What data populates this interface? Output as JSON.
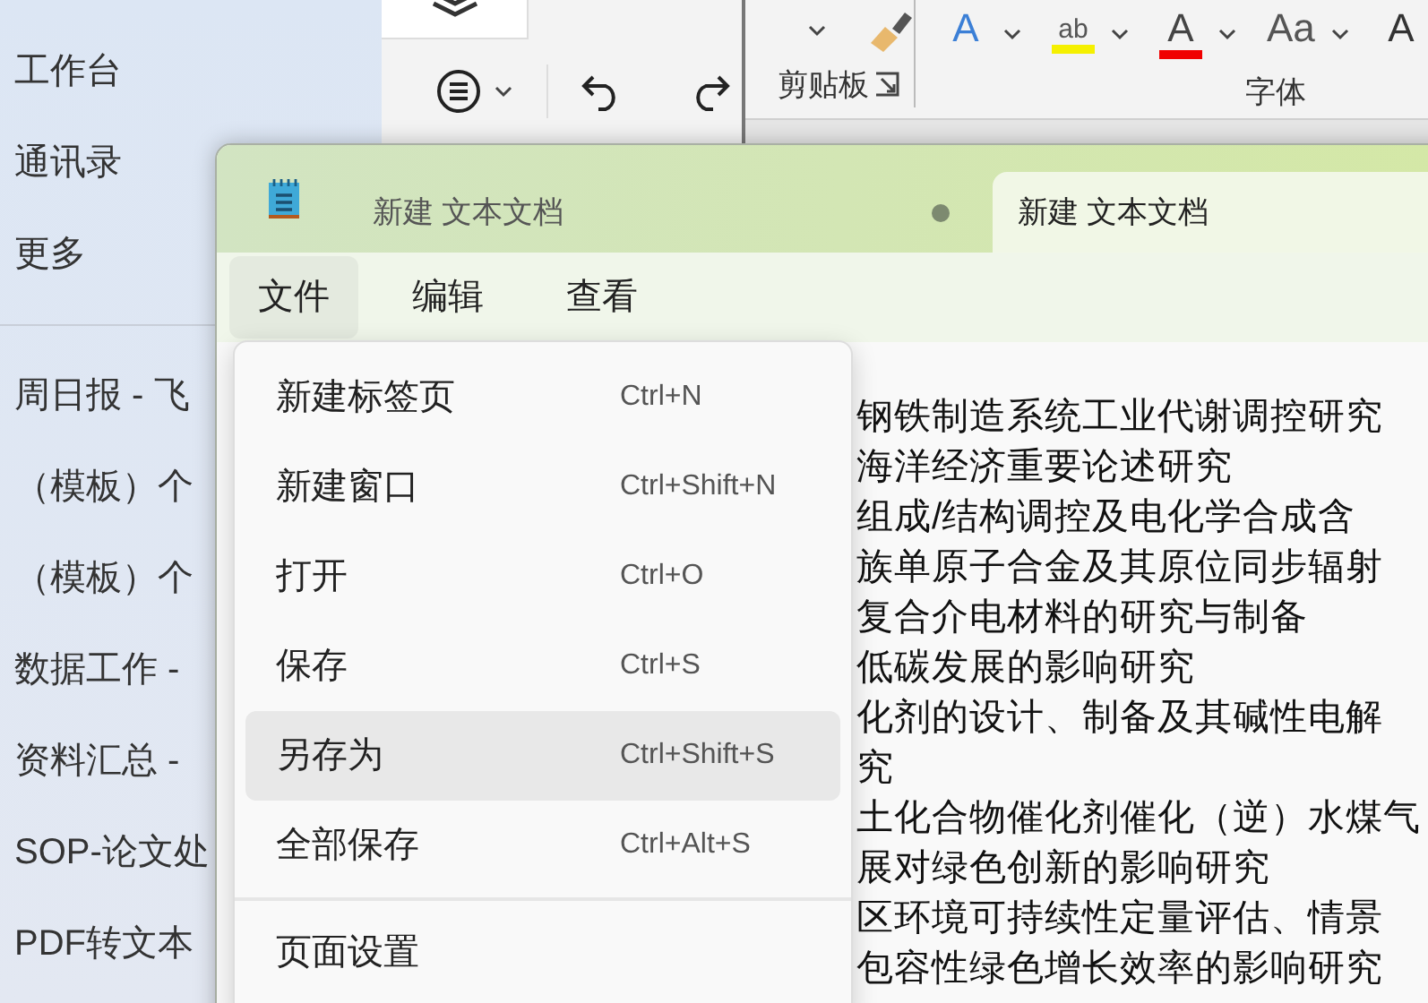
{
  "sidebar": {
    "nav_items": [
      {
        "label": "工作台"
      },
      {
        "label": "通讯录"
      },
      {
        "label": "更多"
      }
    ],
    "documents": [
      {
        "title": "周日报 - 飞"
      },
      {
        "title": "（模板）个"
      },
      {
        "title": "（模板）个"
      },
      {
        "title": "数据工作 -"
      },
      {
        "title": "资料汇总 -"
      },
      {
        "title": "SOP-论文处"
      },
      {
        "title": "PDF转文本"
      }
    ]
  },
  "word_ribbon": {
    "groups": [
      {
        "label": "剪贴板"
      },
      {
        "label": "字体"
      }
    ],
    "font_buttons": [
      {
        "kind": "text-effects",
        "glyph": "A"
      },
      {
        "kind": "highlight",
        "glyph": "ab"
      },
      {
        "kind": "font-color",
        "glyph": "A"
      },
      {
        "kind": "change-case",
        "glyph": "Aa"
      },
      {
        "kind": "grow-font",
        "glyph": "A"
      }
    ]
  },
  "notepad": {
    "tabs": [
      {
        "title": "新建 文本文档",
        "selected": false,
        "unsaved": true
      },
      {
        "title": "新建 文本文档",
        "selected": true,
        "unsaved": false
      }
    ],
    "menu_bar": [
      {
        "label": "文件",
        "selected": true
      },
      {
        "label": "编辑",
        "selected": false
      },
      {
        "label": "查看",
        "selected": false
      }
    ],
    "file_menu": [
      {
        "kind": "command",
        "label": "新建标签页",
        "shortcut": "Ctrl+N",
        "selected": false
      },
      {
        "kind": "command",
        "label": "新建窗口",
        "shortcut": "Ctrl+Shift+N",
        "selected": false
      },
      {
        "kind": "command",
        "label": "打开",
        "shortcut": "Ctrl+O",
        "selected": false
      },
      {
        "kind": "command",
        "label": "保存",
        "shortcut": "Ctrl+S",
        "selected": false
      },
      {
        "kind": "command",
        "label": "另存为",
        "shortcut": "Ctrl+Shift+S",
        "selected": true
      },
      {
        "kind": "command",
        "label": "全部保存",
        "shortcut": "Ctrl+Alt+S",
        "selected": false
      },
      {
        "kind": "separator"
      },
      {
        "kind": "command",
        "label": "页面设置",
        "selected": false
      }
    ],
    "text_lines": [
      "钢铁制造系统工业代谢调控研究",
      "海洋经济重要论述研究",
      "组成/结构调控及电化学合成含",
      "族单原子合金及其原位同步辐射",
      "复合介电材料的研究与制备",
      "低碳发展的影响研究",
      "化剂的设计、制备及其碱性电解",
      "究",
      "土化合物催化剂催化（逆）水煤气",
      "展对绿色创新的影响研究",
      "区环境可持续性定量评估、情景",
      "包容性绿色增长效率的影响研究"
    ]
  }
}
